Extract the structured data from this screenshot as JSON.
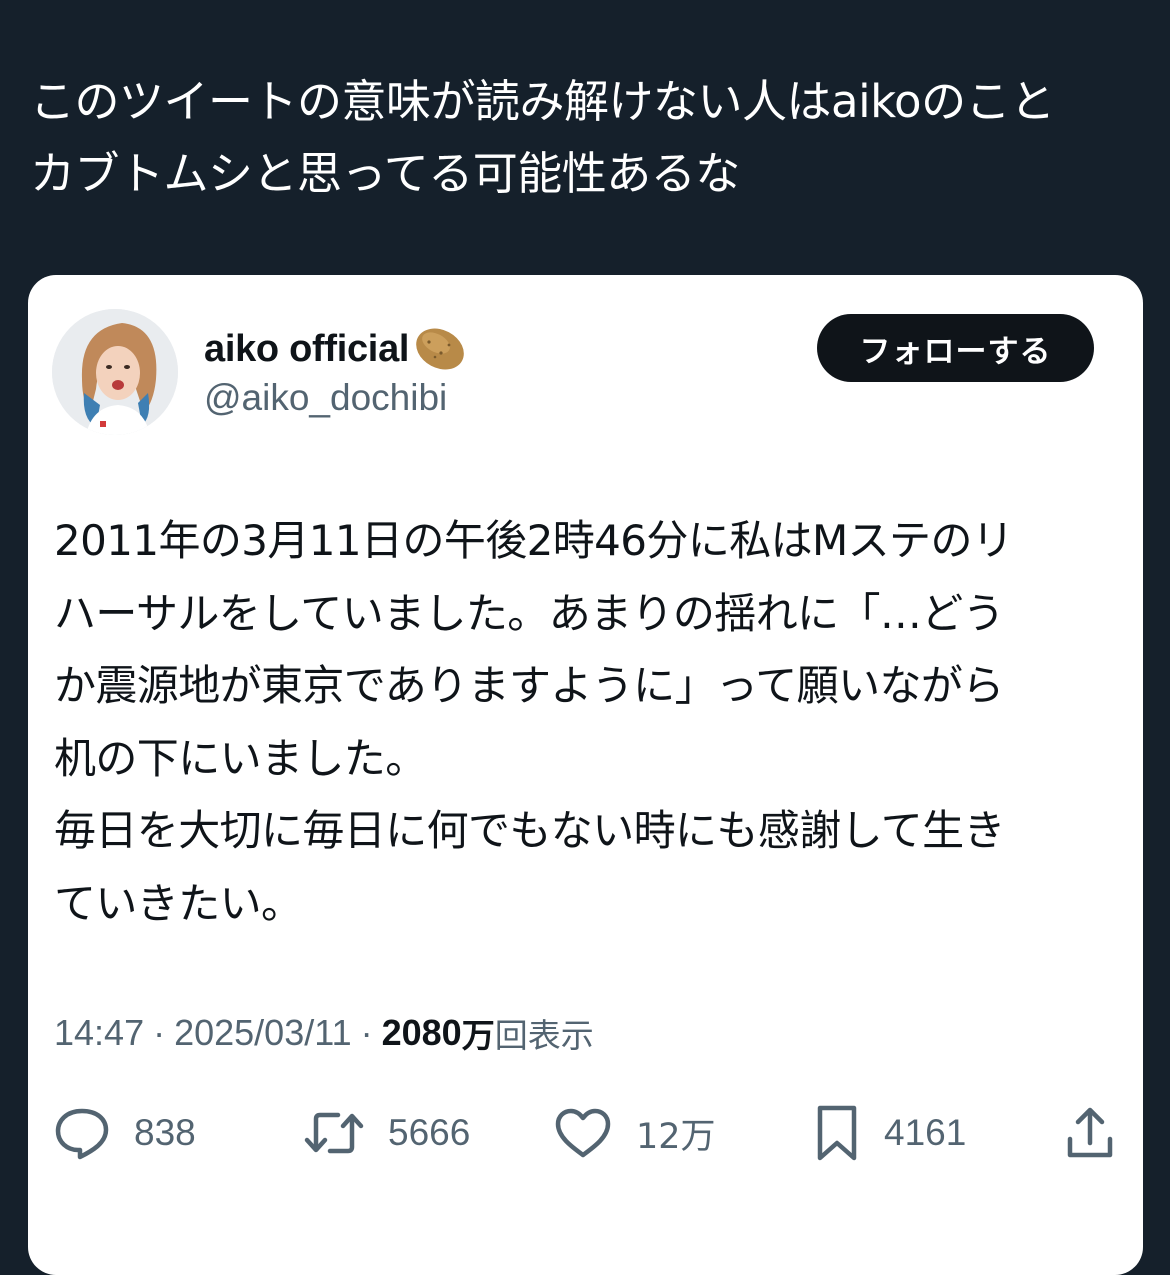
{
  "quote": {
    "lines": [
      "このツイートの意味が読み解けない人はaikoのこと",
      "カブトムシと思ってる可能性あるな"
    ]
  },
  "embedded_tweet": {
    "display_name": "aiko official",
    "name_emoji_icon": "potato-icon",
    "handle": "@aiko_dochibi",
    "follow_label": "フォローする",
    "text_lines": [
      "2011年の3月11日の午後2時46分に私はMステのリ",
      "ハーサルをしていました。あまりの揺れに「…どう",
      "か震源地が東京でありますように」って願いながら",
      "机の下にいました。",
      "毎日を大切に毎日に何でもない時にも感謝して生き",
      "ていきたい。"
    ],
    "meta": {
      "time": "14:47",
      "separator": "·",
      "date": "2025/03/11",
      "views_count": "2080",
      "views_unit": "万",
      "views_label": "回表示"
    },
    "actions": {
      "reply_count": "838",
      "retweet_count": "5666",
      "like_count": "12万",
      "bookmark_count": "4161"
    },
    "colors": {
      "page_background": "#15202b",
      "card_background": "#ffffff",
      "primary_text": "#0f1419",
      "secondary_text": "#536471",
      "follow_button_bg": "#0f1419"
    }
  }
}
